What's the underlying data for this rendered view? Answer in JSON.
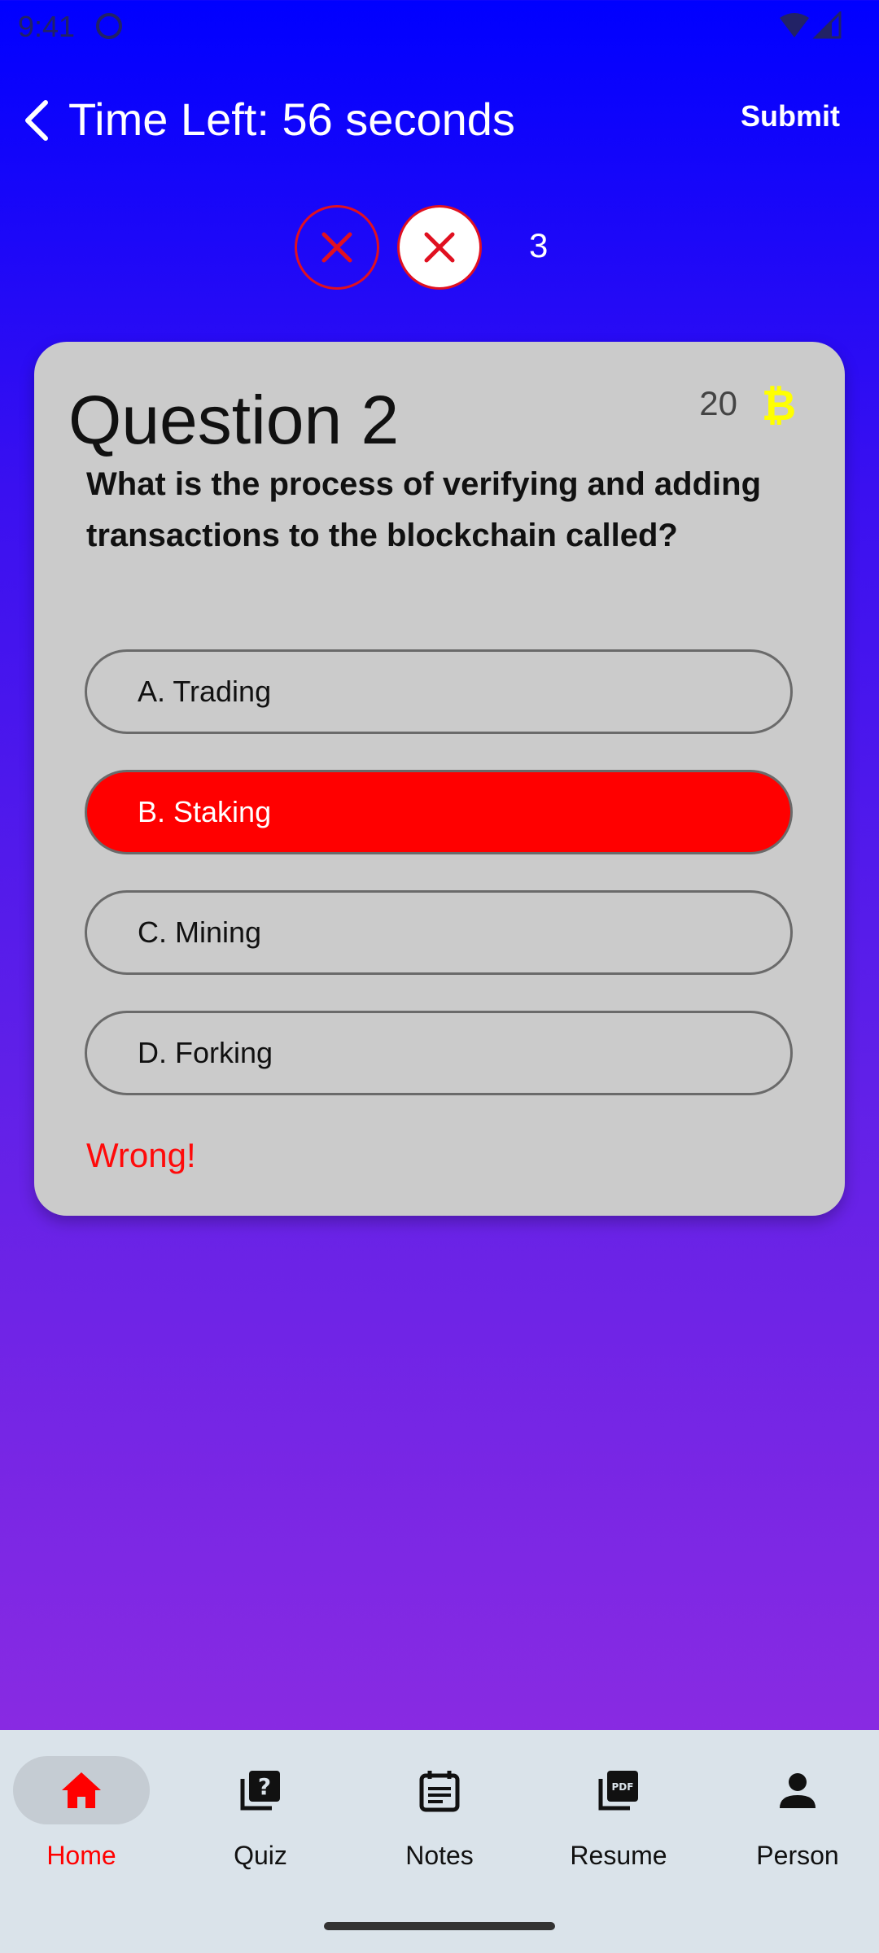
{
  "status_bar": {
    "time": "9:41"
  },
  "header": {
    "title": "Time Left: 56 seconds",
    "submit_label": "Submit"
  },
  "lives": {
    "count": "3"
  },
  "question": {
    "title": "Question 2",
    "points": "20",
    "text": "What is the process of verifying and adding transactions to the blockchain called?",
    "options": [
      {
        "label": "A. Trading",
        "selected": false
      },
      {
        "label": "B. Staking",
        "selected": true
      },
      {
        "label": "C. Mining",
        "selected": false
      },
      {
        "label": "D. Forking",
        "selected": false
      }
    ],
    "feedback": "Wrong!"
  },
  "bottom_nav": {
    "items": [
      {
        "label": "Home",
        "icon": "home-icon",
        "active": true
      },
      {
        "label": "Quiz",
        "icon": "quiz-icon",
        "active": false
      },
      {
        "label": "Notes",
        "icon": "notes-icon",
        "active": false
      },
      {
        "label": "Resume",
        "icon": "pdf-icon",
        "active": false
      },
      {
        "label": "Person",
        "icon": "person-icon",
        "active": false
      }
    ]
  },
  "colors": {
    "background_top": "#0000ff",
    "background_bottom": "#8a2be2",
    "card": "#cbcbcb",
    "wrong": "#ff0000",
    "coin": "#ffff00",
    "nav_bg": "#dae3ea"
  }
}
